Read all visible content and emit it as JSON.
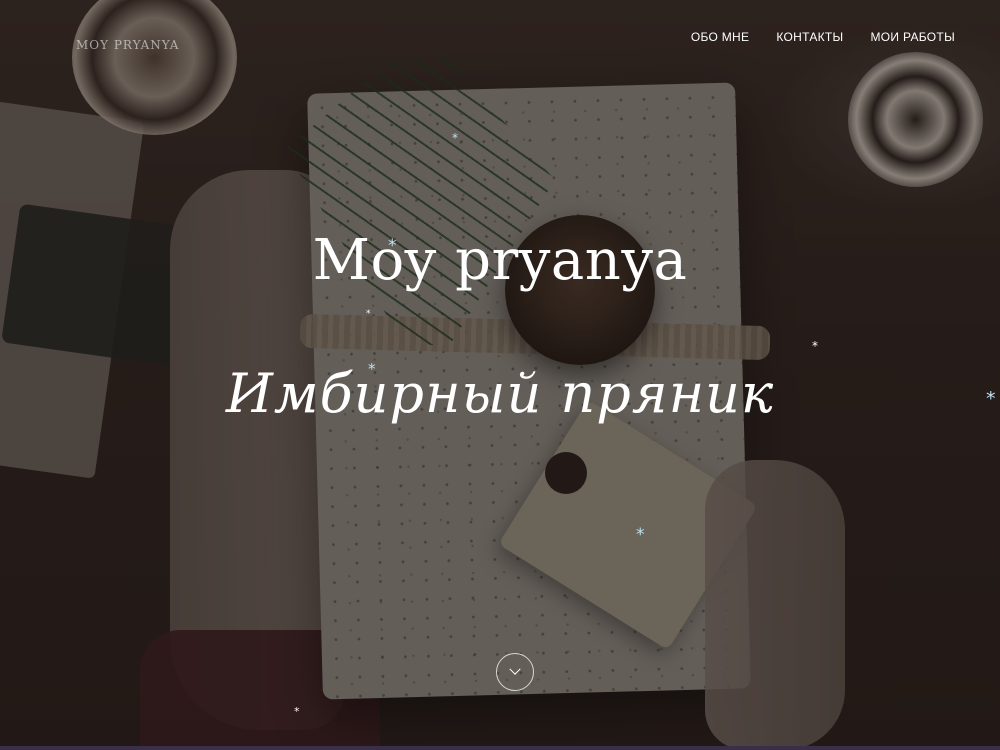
{
  "header": {
    "logo_text": "MOY PRYANYA",
    "nav_items": [
      {
        "label": "ОБО МНЕ"
      },
      {
        "label": "КОНТАКТЫ"
      },
      {
        "label": "МОИ РАБОТЫ"
      }
    ]
  },
  "hero": {
    "title": "Moy pryanya",
    "subtitle": "Имбирный пряник",
    "scroll_icon": "chevron-down-icon"
  },
  "decor": {
    "snowflake_symbol": "*",
    "snowflake_colors": [
      "#bfe0ee",
      "#ffffff"
    ]
  }
}
